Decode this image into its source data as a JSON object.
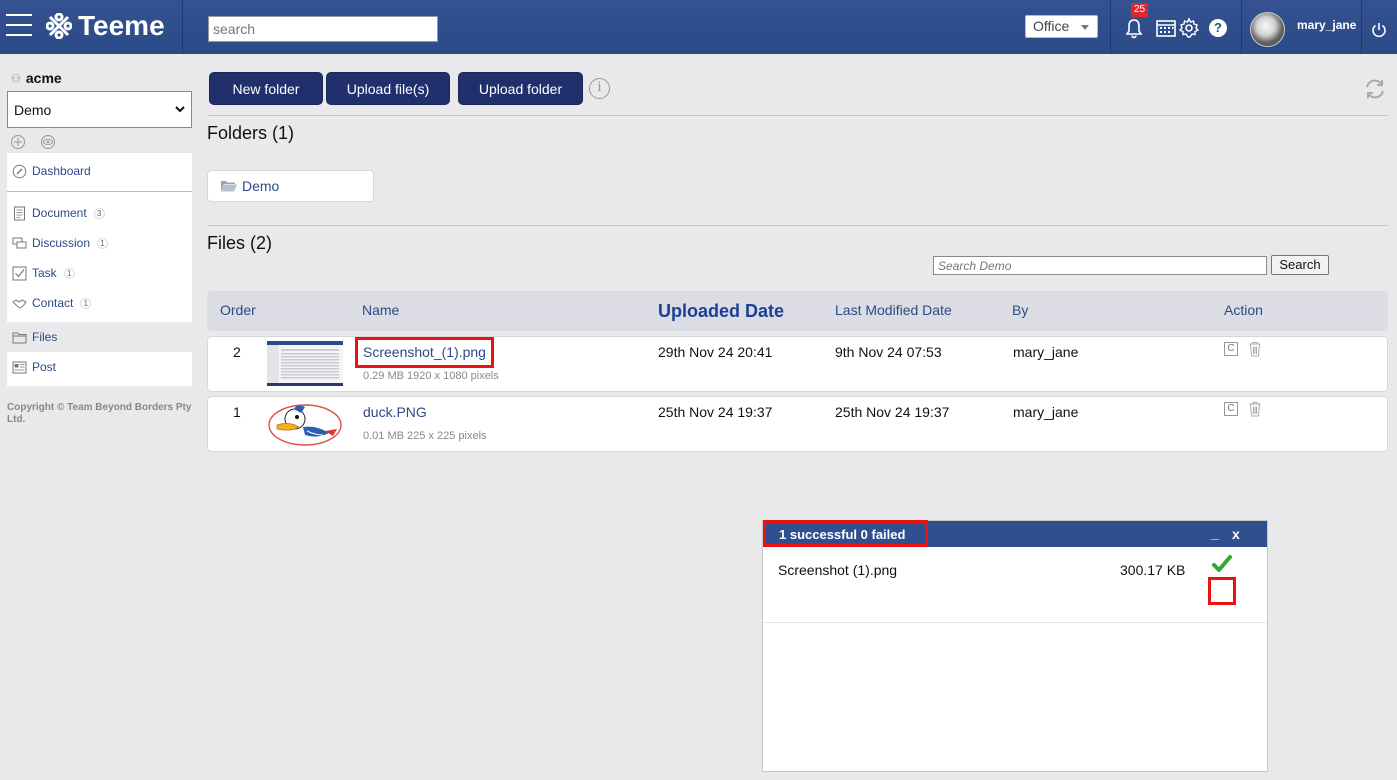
{
  "header": {
    "logo_text": "Teeme",
    "search_placeholder": "search",
    "office_label": "Office",
    "notification_count": "25",
    "username": "mary_jane"
  },
  "sidebar": {
    "org_name": "acme",
    "workspace": "Demo",
    "menu": [
      {
        "label": "Dashboard",
        "icon": "dashboard-icon"
      },
      {
        "label": "Document",
        "count": "3",
        "icon": "document-icon"
      },
      {
        "label": "Discussion",
        "count": "1",
        "icon": "discussion-icon"
      },
      {
        "label": "Task",
        "count": "1",
        "icon": "task-icon"
      },
      {
        "label": "Contact",
        "count": "1",
        "icon": "contact-icon"
      },
      {
        "label": "Files",
        "icon": "folder-icon"
      },
      {
        "label": "Post",
        "icon": "post-icon"
      }
    ],
    "copyright": "Copyright © Team Beyond Borders Pty Ltd."
  },
  "toolbar": {
    "new_folder": "New folder",
    "upload_files": "Upload file(s)",
    "upload_folder": "Upload folder"
  },
  "folders": {
    "title": "Folders (1)",
    "items": [
      {
        "name": "Demo"
      }
    ]
  },
  "files": {
    "title": "Files (2)",
    "search_placeholder": "Search Demo",
    "search_button": "Search",
    "columns": {
      "order": "Order",
      "name": "Name",
      "uploaded": "Uploaded Date",
      "modified": "Last Modified Date",
      "by": "By",
      "action": "Action"
    },
    "rows": [
      {
        "order": "2",
        "name": "Screenshot_(1).png",
        "meta": "0.29 MB  1920 x 1080 pixels",
        "uploaded": "29th Nov 24 20:41",
        "modified": "9th Nov 24 07:53",
        "by": "mary_jane",
        "copy_label": "C"
      },
      {
        "order": "1",
        "name": "duck.PNG",
        "meta": "0.01 MB  225 x 225 pixels",
        "uploaded": "25th Nov 24 19:37",
        "modified": "25th Nov 24 19:37",
        "by": "mary_jane",
        "copy_label": "C"
      }
    ]
  },
  "upload_panel": {
    "title": "1 successful 0 failed",
    "minimize": "_",
    "close": "x",
    "items": [
      {
        "name": "Screenshot (1).png",
        "size": "300.17 KB",
        "status": "success"
      }
    ]
  },
  "colors": {
    "header_bg": "#2b4a88",
    "primary_button": "#21306d",
    "link": "#2b4a88",
    "highlight": "#ee1111",
    "success": "#2eaa2e"
  }
}
